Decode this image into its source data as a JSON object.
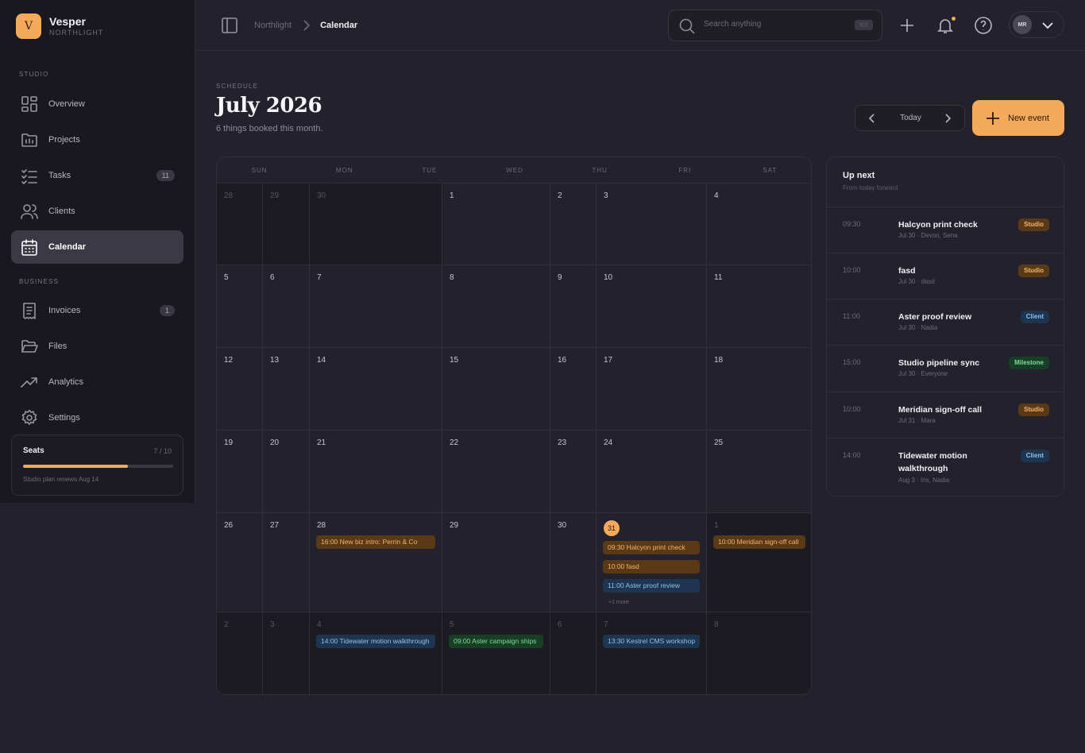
{
  "brand": {
    "logo_letter": "V",
    "name": "Vesper",
    "workspace": "NORTHLIGHT"
  },
  "sidebar": {
    "sections": [
      {
        "label": "STUDIO"
      },
      {
        "label": "BUSINESS"
      }
    ],
    "items": [
      {
        "label": "Overview",
        "icon": "grid-icon"
      },
      {
        "label": "Projects",
        "icon": "folder-icon"
      },
      {
        "label": "Tasks",
        "icon": "checklist-icon",
        "badge": "11"
      },
      {
        "label": "Clients",
        "icon": "users-icon"
      },
      {
        "label": "Calendar",
        "icon": "calendar-icon",
        "active": true
      },
      {
        "label": "Invoices",
        "icon": "receipt-icon",
        "badge": "1"
      },
      {
        "label": "Files",
        "icon": "folder-open-icon"
      },
      {
        "label": "Analytics",
        "icon": "trend-icon"
      },
      {
        "label": "Settings",
        "icon": "gear-icon"
      }
    ],
    "seats": {
      "title": "Seats",
      "count": "7 / 10",
      "used_fraction": 0.7,
      "note": "Studio plan renews Aug 14"
    }
  },
  "topbar": {
    "breadcrumb_parent": "Northlight",
    "breadcrumb_current": "Calendar",
    "search_placeholder": "Search anything",
    "search_shortcut": "⌘K",
    "user_initials": "MR"
  },
  "header": {
    "eyebrow": "SCHEDULE",
    "title": "July 2026",
    "subtitle": "6 things booked this month.",
    "today_label": "Today",
    "new_event_label": "New event"
  },
  "calendar": {
    "weekdays": [
      "SUN",
      "MON",
      "TUE",
      "WED",
      "THU",
      "FRI",
      "SAT"
    ],
    "weeks": [
      [
        {
          "day": "28",
          "out": true
        },
        {
          "day": "29",
          "out": true
        },
        {
          "day": "30",
          "out": true
        },
        {
          "day": "1"
        },
        {
          "day": "2"
        },
        {
          "day": "3"
        },
        {
          "day": "4"
        }
      ],
      [
        {
          "day": "5"
        },
        {
          "day": "6"
        },
        {
          "day": "7"
        },
        {
          "day": "8"
        },
        {
          "day": "9"
        },
        {
          "day": "10"
        },
        {
          "day": "11"
        }
      ],
      [
        {
          "day": "12"
        },
        {
          "day": "13"
        },
        {
          "day": "14"
        },
        {
          "day": "15"
        },
        {
          "day": "16"
        },
        {
          "day": "17"
        },
        {
          "day": "18"
        }
      ],
      [
        {
          "day": "19"
        },
        {
          "day": "20"
        },
        {
          "day": "21"
        },
        {
          "day": "22"
        },
        {
          "day": "23"
        },
        {
          "day": "24"
        },
        {
          "day": "25"
        }
      ],
      [
        {
          "day": "26"
        },
        {
          "day": "27"
        },
        {
          "day": "28",
          "events": [
            {
              "text": "16:00 New biz intro: Perrin & Co",
              "kind": "studio"
            }
          ]
        },
        {
          "day": "29"
        },
        {
          "day": "30"
        },
        {
          "day": "31",
          "today": true,
          "events": [
            {
              "text": "09:30 Halcyon print check",
              "kind": "studio"
            },
            {
              "text": "10:00 fasd",
              "kind": "studio"
            },
            {
              "text": "11:00 Aster proof review",
              "kind": "client"
            }
          ],
          "more": "+1 more"
        },
        {
          "day": "1",
          "out": true,
          "events": [
            {
              "text": "10:00 Meridian sign-off call",
              "kind": "studio"
            }
          ]
        }
      ],
      [
        {
          "day": "2",
          "out": true
        },
        {
          "day": "3",
          "out": true
        },
        {
          "day": "4",
          "out": true,
          "events": [
            {
              "text": "14:00 Tidewater motion walkthrough",
              "kind": "client"
            }
          ]
        },
        {
          "day": "5",
          "out": true,
          "events": [
            {
              "text": "09:00 Aster campaign ships",
              "kind": "milestone"
            }
          ]
        },
        {
          "day": "6",
          "out": true
        },
        {
          "day": "7",
          "out": true,
          "events": [
            {
              "text": "13:30 Kestrel CMS workshop",
              "kind": "client"
            }
          ]
        },
        {
          "day": "8",
          "out": true
        }
      ]
    ]
  },
  "up_next": {
    "title": "Up next",
    "subtitle": "From today forward",
    "items": [
      {
        "time": "09:30",
        "name": "Halcyon print check",
        "meta": "Jul 30 · Devon, Sena",
        "tag": "Studio",
        "kind": "studio"
      },
      {
        "time": "10:00",
        "name": "fasd",
        "meta": "Jul 30 · dasd",
        "tag": "Studio",
        "kind": "studio"
      },
      {
        "time": "11:00",
        "name": "Aster proof review",
        "meta": "Jul 30 · Nadia",
        "tag": "Client",
        "kind": "client"
      },
      {
        "time": "15:00",
        "name": "Studio pipeline sync",
        "meta": "Jul 30 · Everyone",
        "tag": "Milestone",
        "kind": "milestone"
      },
      {
        "time": "10:00",
        "name": "Meridian sign-off call",
        "meta": "Jul 31 · Mara",
        "tag": "Studio",
        "kind": "studio"
      },
      {
        "time": "14:00",
        "name": "Tidewater motion walkthrough",
        "meta": "Aug 3 · Iris, Nadia",
        "tag": "Client",
        "kind": "client"
      }
    ]
  },
  "colors": {
    "accent": "#f5a95a",
    "studio": "#5a3a16",
    "client": "#1d3550",
    "milestone": "#173f26"
  }
}
